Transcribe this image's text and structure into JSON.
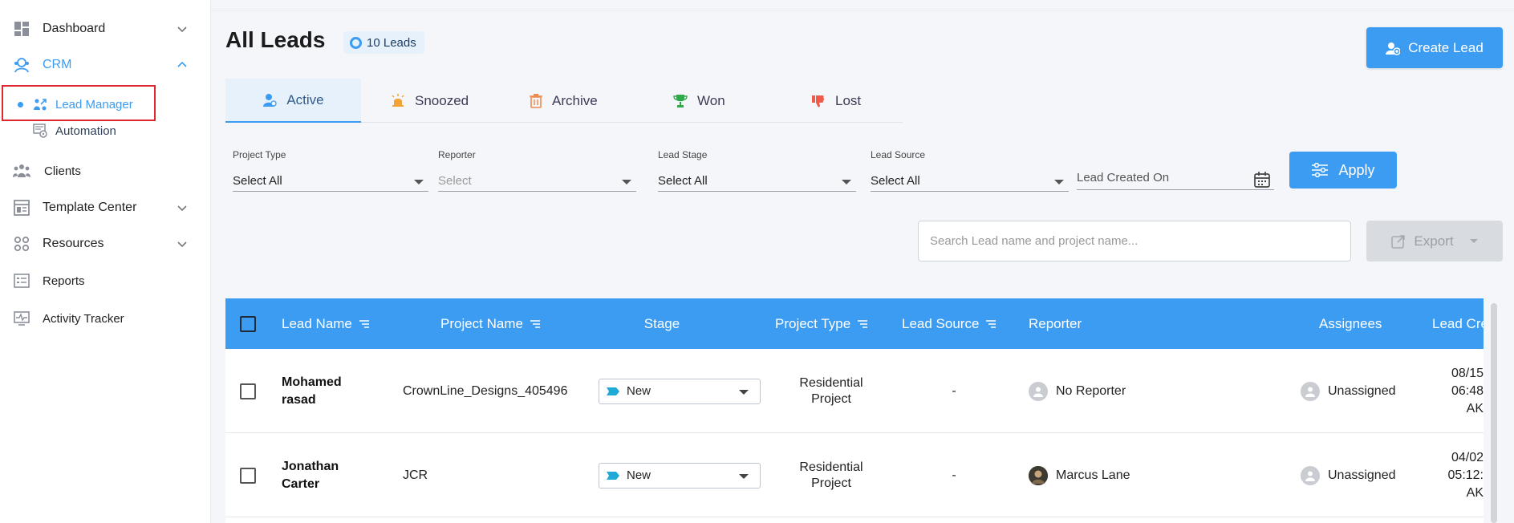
{
  "sidebar": {
    "items": [
      {
        "label": "Dashboard",
        "icon": "dashboard-icon"
      },
      {
        "label": "CRM",
        "icon": "crm-icon"
      },
      {
        "label": "Lead Manager",
        "icon": "lead-manager-icon"
      },
      {
        "label": "Automation",
        "icon": "automation-icon"
      },
      {
        "label": "Clients",
        "icon": "clients-icon"
      },
      {
        "label": "Template Center",
        "icon": "template-center-icon"
      },
      {
        "label": "Resources",
        "icon": "resources-icon"
      },
      {
        "label": "Reports",
        "icon": "reports-icon"
      },
      {
        "label": "Activity Tracker",
        "icon": "activity-tracker-icon"
      }
    ]
  },
  "header": {
    "title": "All Leads",
    "lead_count": "10 Leads",
    "create_label": "Create Lead"
  },
  "tabs": [
    {
      "label": "Active",
      "icon": "person-icon"
    },
    {
      "label": "Snoozed",
      "icon": "alarm-icon"
    },
    {
      "label": "Archive",
      "icon": "trash-icon"
    },
    {
      "label": "Won",
      "icon": "trophy-icon"
    },
    {
      "label": "Lost",
      "icon": "thumbs-down-icon"
    }
  ],
  "filters": {
    "project_type": {
      "label": "Project Type",
      "value": "Select All"
    },
    "reporter": {
      "label": "Reporter",
      "value": "Select"
    },
    "lead_stage": {
      "label": "Lead Stage",
      "value": "Select All"
    },
    "lead_source": {
      "label": "Lead Source",
      "value": "Select All"
    },
    "lead_created_on": {
      "placeholder": "Lead Created On"
    },
    "apply_label": "Apply"
  },
  "search": {
    "placeholder": "Search Lead name and project name..."
  },
  "export_label": "Export",
  "table": {
    "columns": [
      "Lead Name",
      "Project Name",
      "Stage",
      "Project Type",
      "Lead Source",
      "Reporter",
      "Assignees",
      "Lead Cre"
    ],
    "rows": [
      {
        "lead_name_1": "Mohamed",
        "lead_name_2": "rasad",
        "project_name": "CrownLine_Designs_405496",
        "stage": "New",
        "project_type_1": "Residential",
        "project_type_2": "Project",
        "lead_source": "-",
        "reporter": "No Reporter",
        "assignees": "Unassigned",
        "date_1": "08/15",
        "date_2": "06:48",
        "date_3": "AK"
      },
      {
        "lead_name_1": "Jonathan",
        "lead_name_2": "Carter",
        "project_name": "JCR",
        "stage": "New",
        "project_type_1": "Residential",
        "project_type_2": "Project",
        "lead_source": "-",
        "reporter": "Marcus Lane",
        "assignees": "Unassigned",
        "date_1": "04/02",
        "date_2": "05:12:",
        "date_3": "AK"
      }
    ]
  },
  "colors": {
    "accent": "#3b9cf2",
    "highlight_box": "#e0262f"
  }
}
